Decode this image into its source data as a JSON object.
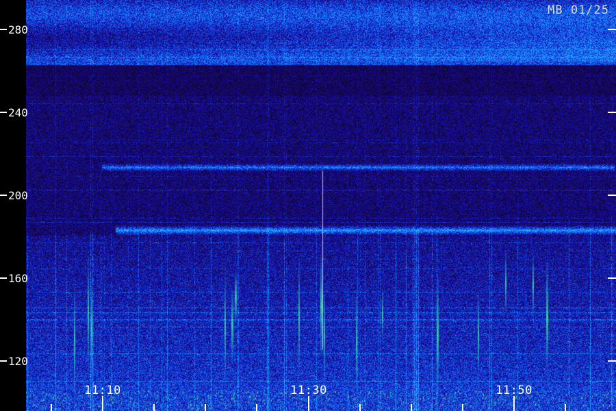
{
  "image": {
    "stamp": "MB 01/25",
    "colors": {
      "background": "#12083a",
      "band": "#1a8cff",
      "noise_low": "#1f10a0",
      "noise_high": "#18b4ff",
      "spike": "#40ff90"
    }
  },
  "y_axis": {
    "labels": [
      "280",
      "240",
      "200",
      "160",
      "120"
    ],
    "values": [
      280,
      240,
      200,
      160,
      120
    ],
    "range": [
      108,
      292
    ]
  },
  "x_axis": {
    "labels": [
      "11:10",
      "11:30",
      "11:50"
    ],
    "minutes": [
      10,
      30,
      50
    ],
    "range_minutes": [
      5,
      62
    ],
    "minor_tick_interval_minutes": 5
  }
}
